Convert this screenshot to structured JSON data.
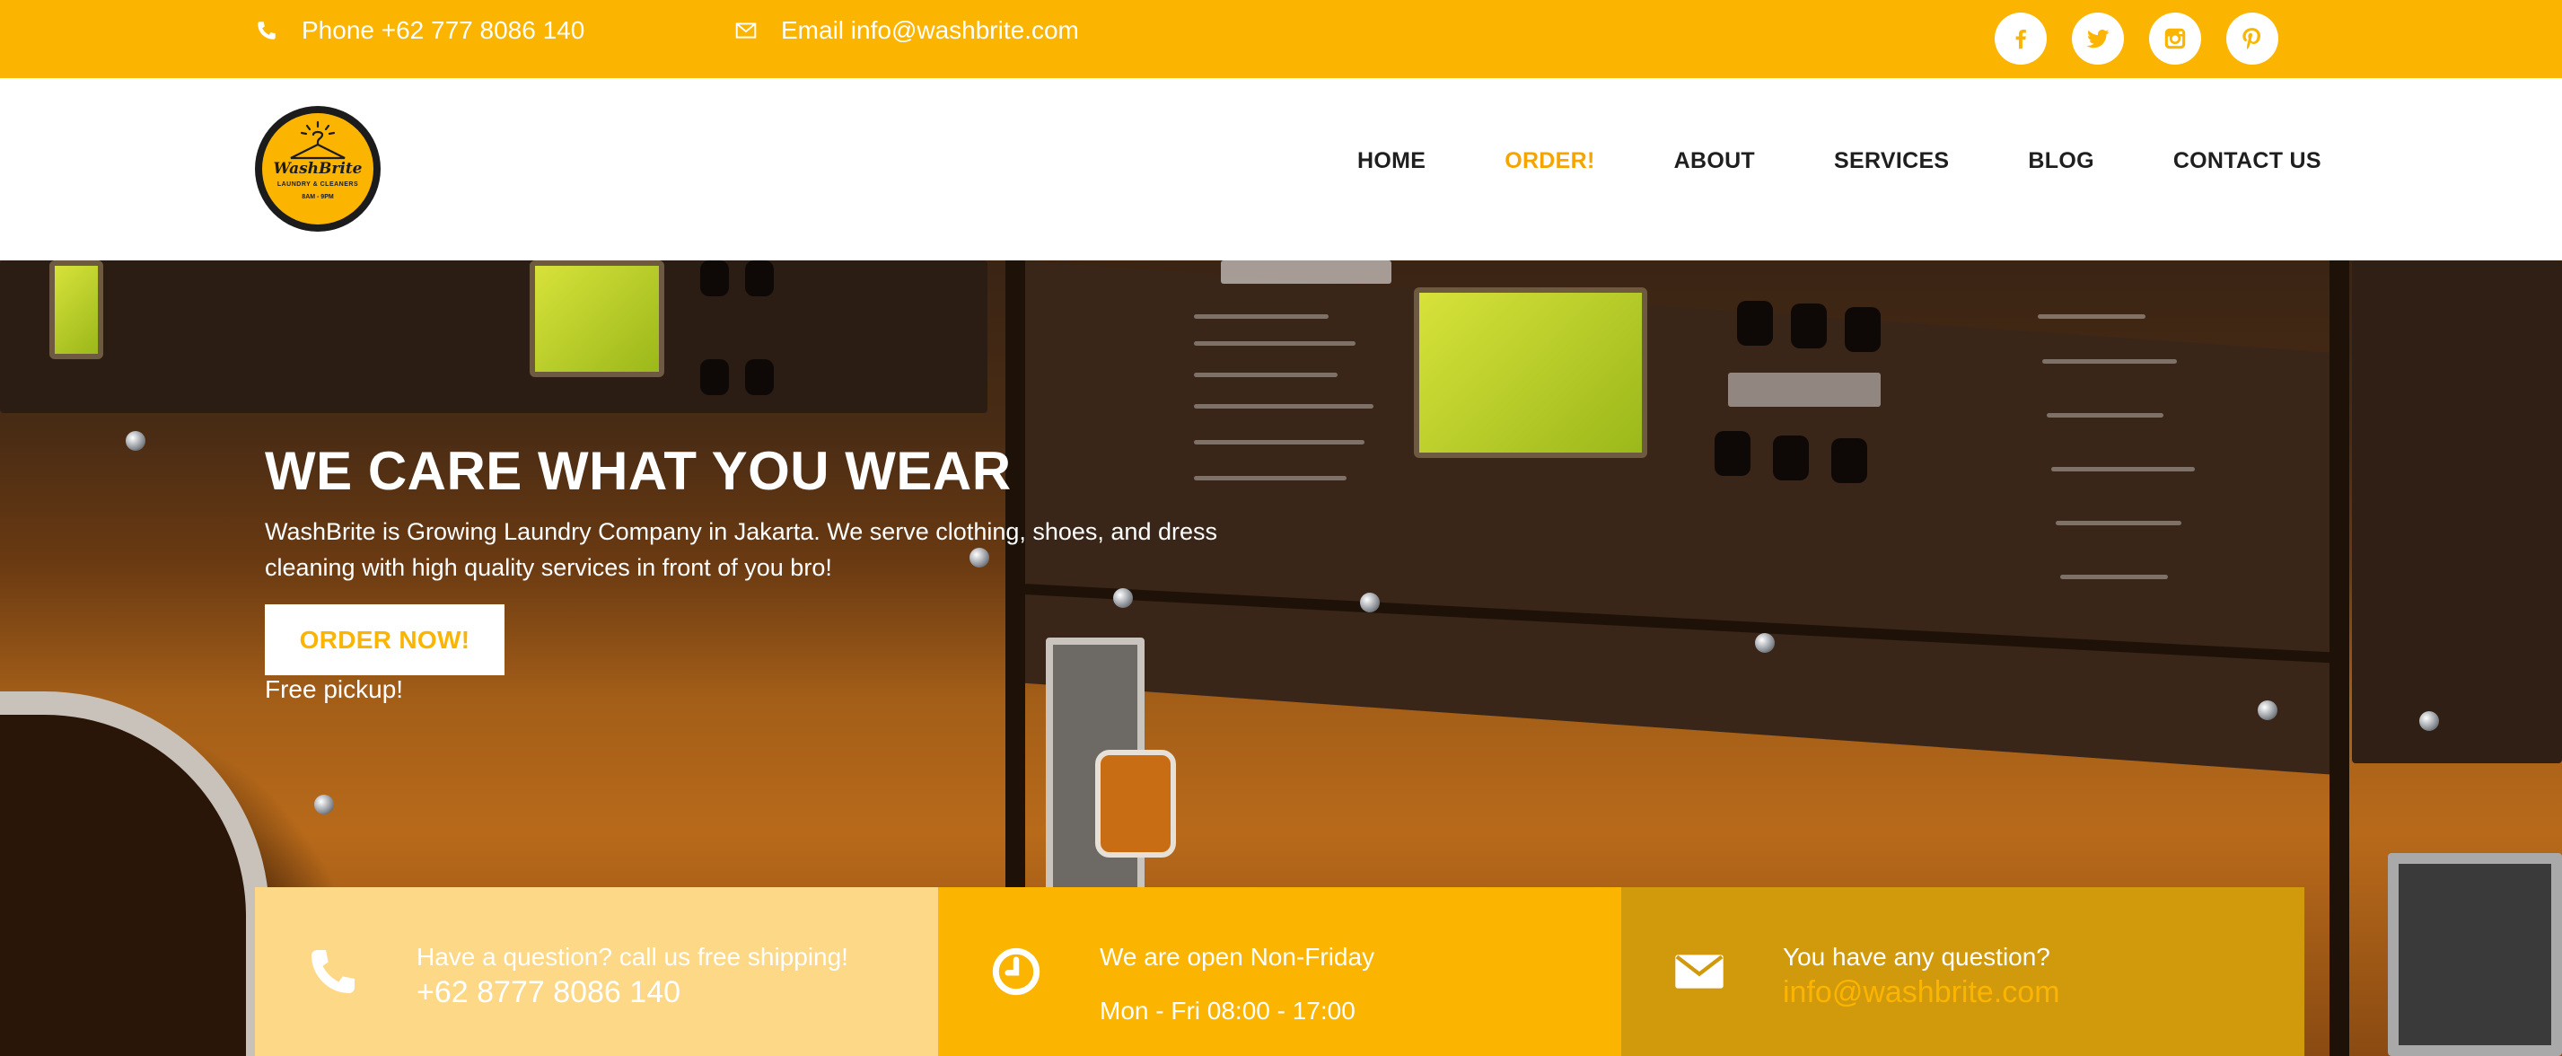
{
  "topbar": {
    "phone_label": "Phone +62 777 8086 140",
    "email_label": "Email info@washbrite.com",
    "social": [
      "facebook-icon",
      "twitter-icon",
      "instagram-icon",
      "pinterest-icon"
    ]
  },
  "logo": {
    "brand": "WashBrite",
    "tagline": "LAUNDRY & CLEANERS",
    "hours": "8AM - 9PM"
  },
  "nav": {
    "items": [
      {
        "label": "HOME"
      },
      {
        "label": "ORDER!"
      },
      {
        "label": "ABOUT"
      },
      {
        "label": "SERVICES"
      },
      {
        "label": "BLOG"
      },
      {
        "label": "CONTACT US"
      }
    ],
    "active": "ORDER!"
  },
  "hero": {
    "title": "WE CARE WHAT YOU WEAR",
    "description": "WashBrite is Growing Laundry Company in Jakarta. We serve clothing, shoes, and dress cleaning with high quality services in front of you bro!",
    "button_label": "ORDER NOW!",
    "note": "Free pickup!"
  },
  "info_boxes": [
    {
      "icon": "phone-icon",
      "line1": "Have a question? call us free shipping!",
      "line2": "+62 8777 8086 140"
    },
    {
      "icon": "clock-icon",
      "line1": "We are open Non-Friday",
      "line2": "Mon - Fri 08:00 - 17:00"
    },
    {
      "icon": "envelope-icon",
      "line1": "You have any question?",
      "line2": "info@washbrite.com"
    }
  ],
  "colors": {
    "accent": "#fbb400",
    "nav_active": "#f5a400",
    "info1_bg": "#fdd886",
    "info2_bg": "#fbb400",
    "info3_bg": "#d19a0c"
  }
}
